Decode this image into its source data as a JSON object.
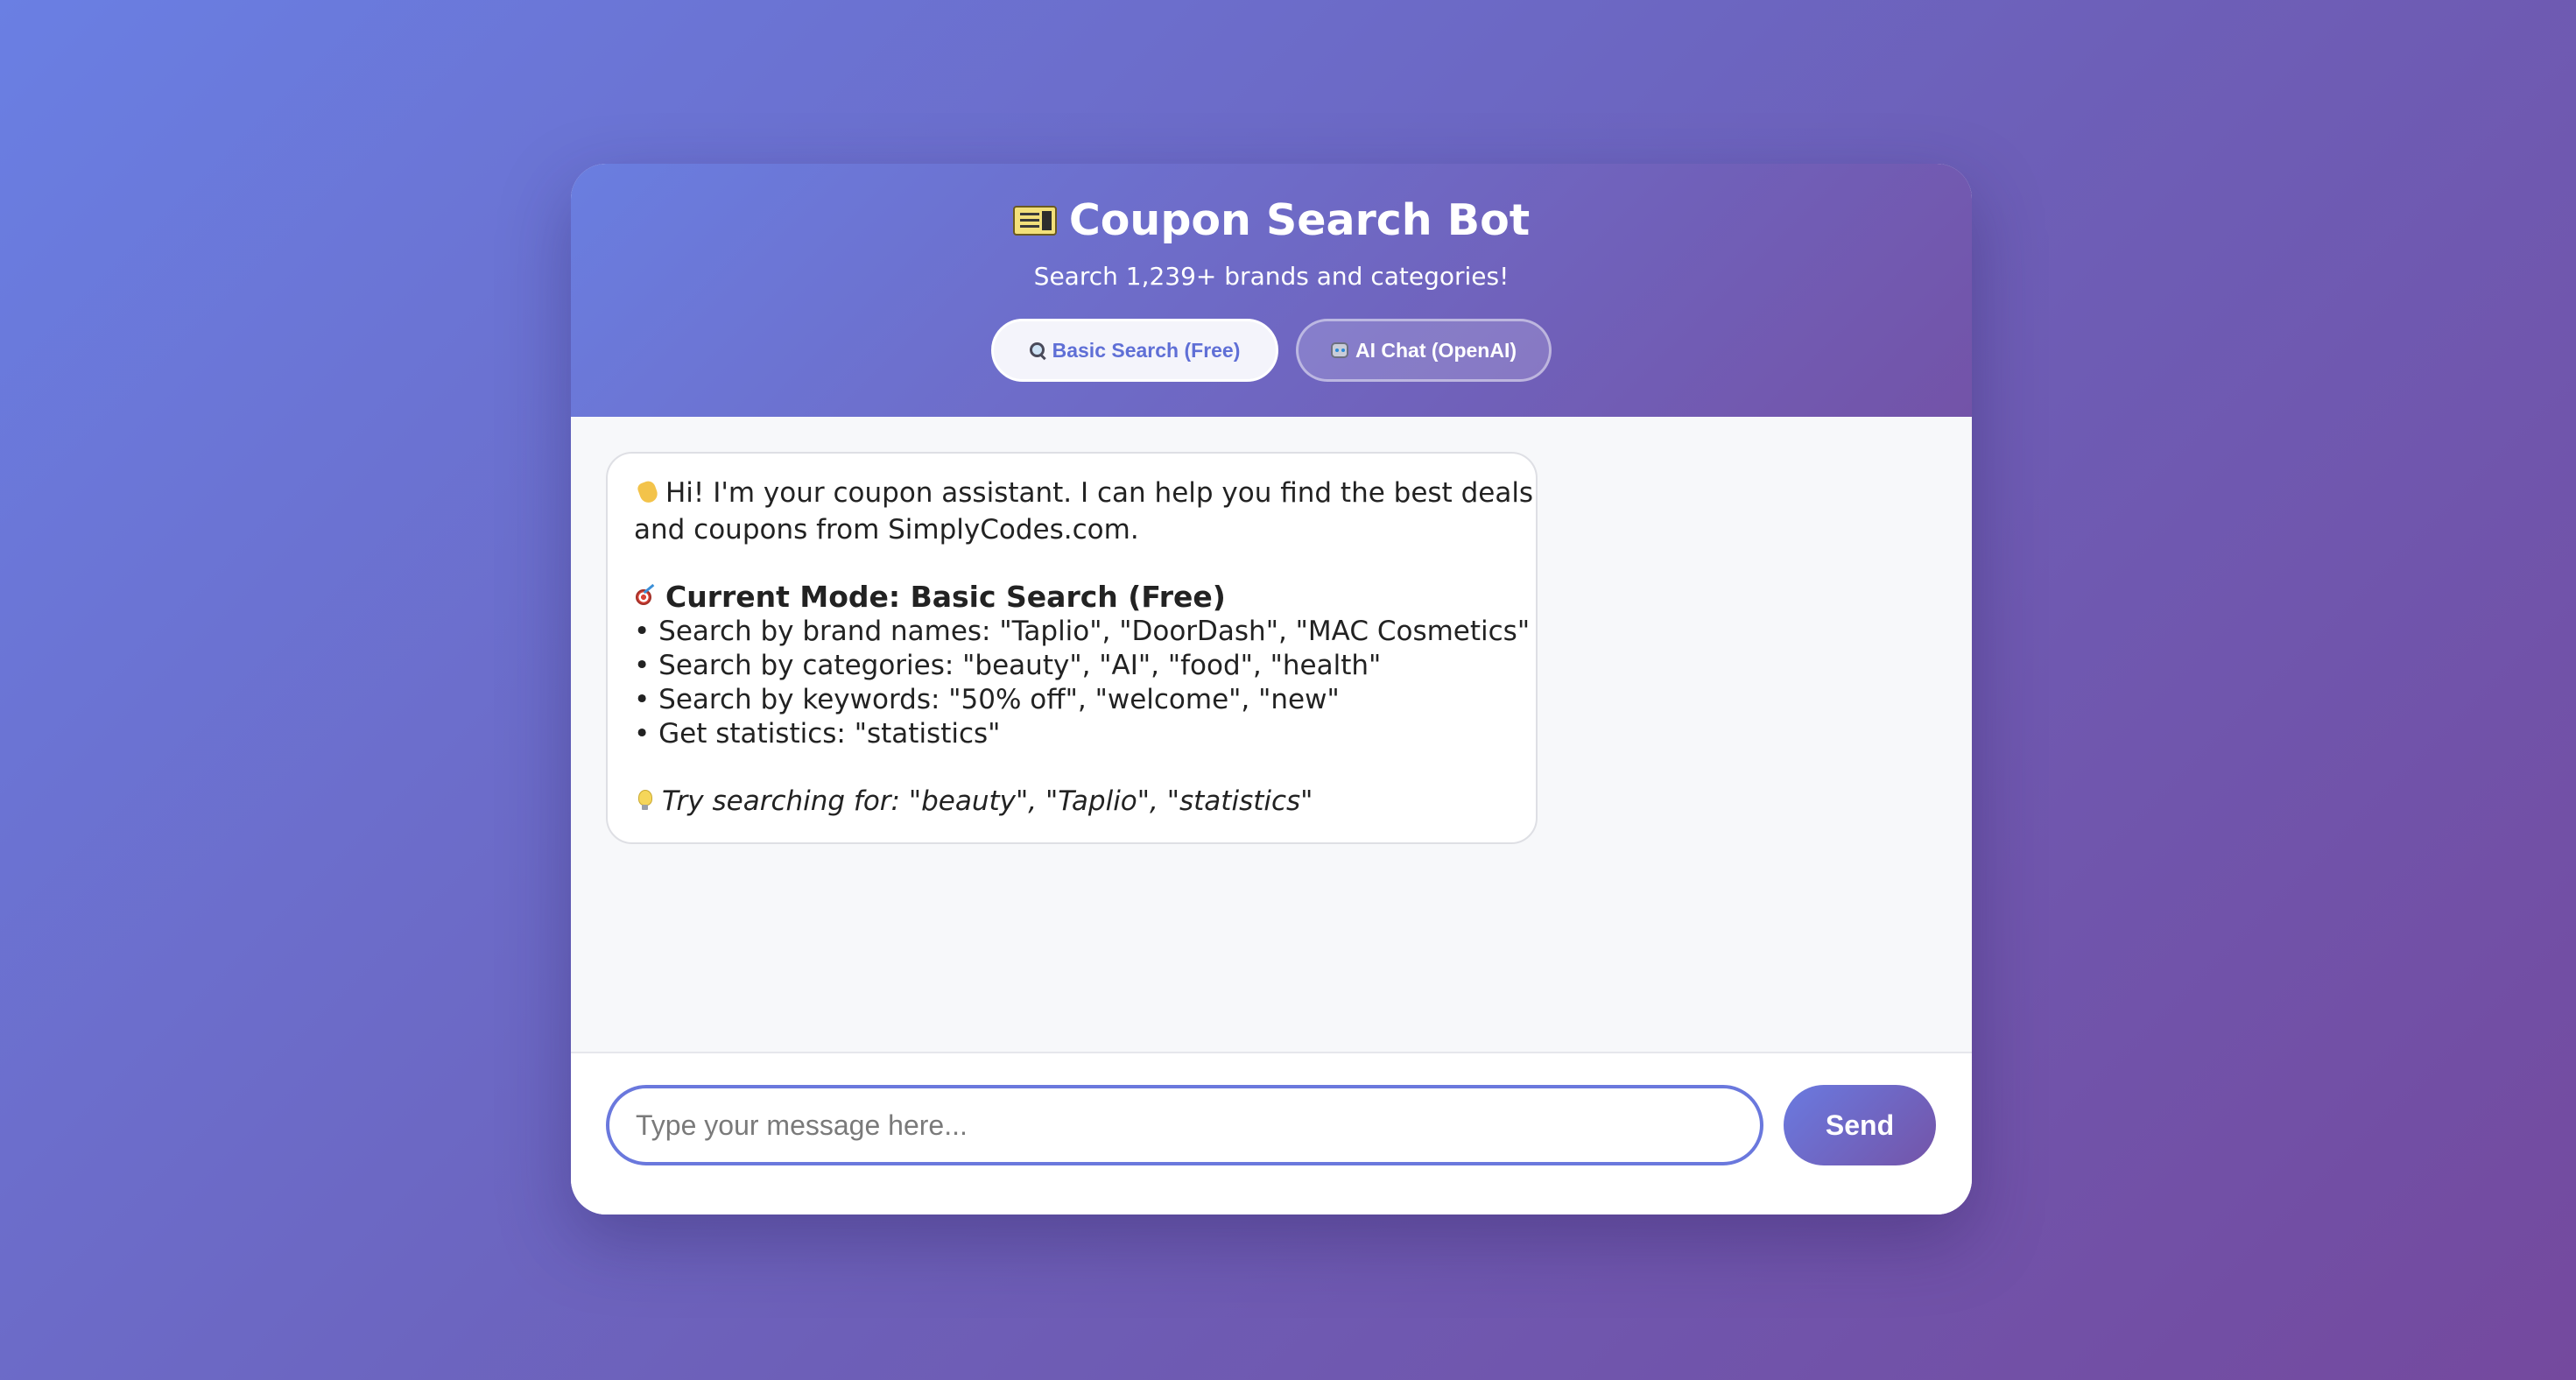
{
  "header": {
    "title": "Coupon Search Bot",
    "subtitle": "Search 1,239+ brands and categories!",
    "title_icon": "ticket-icon",
    "modes": [
      {
        "label": "Basic Search (Free)",
        "icon": "magnifier-icon",
        "active": true
      },
      {
        "label": "AI Chat (OpenAI)",
        "icon": "robot-icon",
        "active": false
      }
    ]
  },
  "chat": {
    "messages": [
      {
        "sender": "bot",
        "greeting_line1": "Hi! I'm your coupon assistant. I can help you find the best deals",
        "greeting_line2": "and coupons from SimplyCodes.com.",
        "mode_heading": "Current Mode: Basic Search (Free)",
        "bullets": [
          "• Search by brand names: \"Taplio\", \"DoorDash\", \"MAC Cosmetics\"",
          "• Search by categories: \"beauty\", \"AI\", \"food\", \"health\"",
          "• Search by keywords: \"50% off\", \"welcome\", \"new\"",
          "• Get statistics: \"statistics\""
        ],
        "tip": "Try searching for: \"beauty\", \"Taplio\", \"statistics\""
      }
    ]
  },
  "composer": {
    "placeholder": "Type your message here...",
    "value": "",
    "send_label": "Send"
  },
  "colors": {
    "accent": "#6a78dd",
    "header_gradient_start": "#6a7ee0",
    "header_gradient_end": "#7353a8"
  }
}
